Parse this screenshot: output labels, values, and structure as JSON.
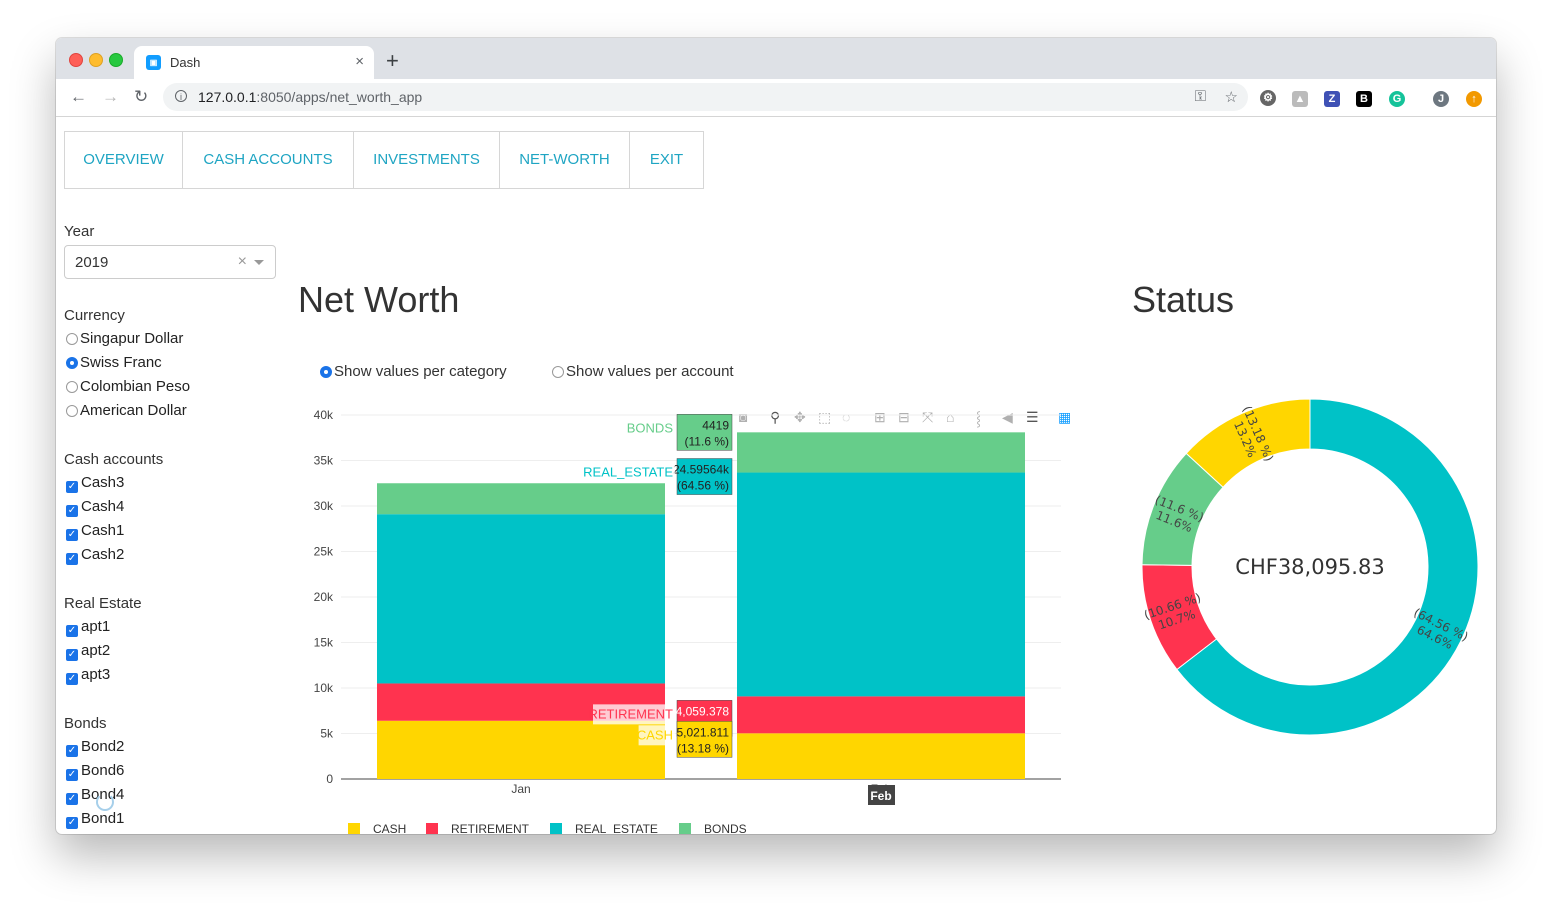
{
  "browser": {
    "tab_title": "Dash",
    "tab_close": "×",
    "new_tab": "+",
    "url_host": "127.0.0.1",
    "url_rest": ":8050/apps/net_worth_app",
    "back": "←",
    "forward": "→",
    "reload": "↻",
    "ext_icons": [
      "key-icon",
      "star-icon",
      "puzzle-icon",
      "drive-icon",
      "z-extension",
      "b-extension",
      "grammarly-icon",
      "profile-avatar",
      "update-icon"
    ]
  },
  "nav": {
    "tabs": [
      {
        "label": "OVERVIEW"
      },
      {
        "label": "CASH ACCOUNTS"
      },
      {
        "label": "INVESTMENTS"
      },
      {
        "label": "NET-WORTH"
      },
      {
        "label": "EXIT"
      }
    ]
  },
  "sidebar": {
    "year_label": "Year",
    "year_value": "2019",
    "year_clear": "×",
    "currency_label": "Currency",
    "currencies": [
      {
        "label": "Singapur Dollar",
        "selected": false
      },
      {
        "label": "Swiss Franc",
        "selected": true
      },
      {
        "label": "Colombian Peso",
        "selected": false
      },
      {
        "label": "American Dollar",
        "selected": false
      }
    ],
    "cash_label": "Cash accounts",
    "cash_accounts": [
      "Cash3",
      "Cash4",
      "Cash1",
      "Cash2"
    ],
    "real_estate_label": "Real Estate",
    "real_estate": [
      "apt1",
      "apt2",
      "apt3"
    ],
    "bonds_label": "Bonds",
    "bonds": [
      "Bond2",
      "Bond6",
      "Bond4",
      "Bond1"
    ]
  },
  "main": {
    "title": "Net Worth",
    "view_options": [
      {
        "label": "Show values per category",
        "selected": true
      },
      {
        "label": "Show values per account",
        "selected": false
      }
    ]
  },
  "status": {
    "title": "Status",
    "center_text": "CHF38,095.83"
  },
  "colors": {
    "cash": "#ffd600",
    "retirement": "#ff334f",
    "real_estate": "#00c2c7",
    "bonds": "#66cd8a",
    "link": "#1fa5c3"
  },
  "chart_data": [
    {
      "type": "bar",
      "stacked": true,
      "categories": [
        "Jan",
        "Feb"
      ],
      "series": [
        {
          "name": "CASH",
          "values": [
            6400,
            5021.811
          ]
        },
        {
          "name": "RETIREMENT",
          "values": [
            4100,
            4059.378
          ]
        },
        {
          "name": "REAL_ESTATE",
          "values": [
            18600,
            24595.64
          ]
        },
        {
          "name": "BONDS",
          "values": [
            3400,
            4419
          ]
        }
      ],
      "ylim": [
        0,
        40000
      ],
      "yticks": [
        "0",
        "5k",
        "10k",
        "15k",
        "20k",
        "25k",
        "30k",
        "35k",
        "40k"
      ],
      "legend_position": "bottom",
      "hover_labels": [
        {
          "series": "BONDS",
          "value": "4419",
          "pct": "(11.6 %)"
        },
        {
          "series": "REAL_ESTATE",
          "value": "24.59564k",
          "pct": "(64.56 %)"
        },
        {
          "series": "RETIREMENT",
          "value": "4,059.378",
          "pct": "(10.66 %)"
        },
        {
          "series": "CASH",
          "value": "5,021.811",
          "pct": "(13.18 %)"
        }
      ],
      "x_hover": "Feb"
    },
    {
      "type": "pie",
      "hole": true,
      "slices": [
        {
          "name": "REAL_ESTATE",
          "value": 64.56,
          "text": "(64.56 %)",
          "sub": "64.6%"
        },
        {
          "name": "RETIREMENT",
          "value": 10.66,
          "text": "(10.66 %)",
          "sub": "10.7%"
        },
        {
          "name": "BONDS",
          "value": 11.6,
          "text": "(11.6 %)",
          "sub": "11.6%"
        },
        {
          "name": "CASH",
          "value": 13.18,
          "text": "(13.18 %)",
          "sub": "13.2%"
        }
      ]
    }
  ]
}
